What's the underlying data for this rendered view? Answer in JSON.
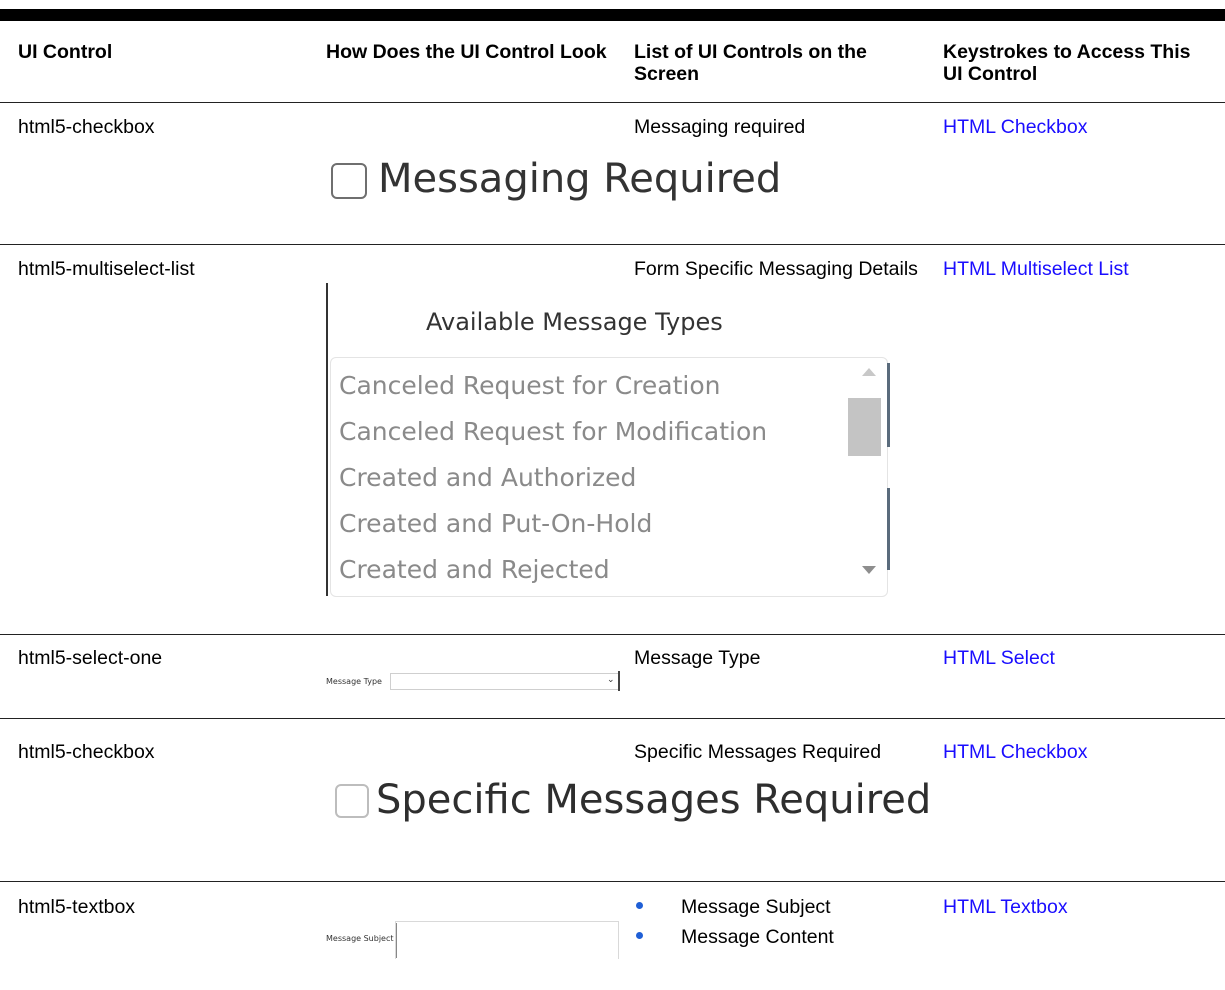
{
  "headers": {
    "col1": "UI Control",
    "col2": "How Does the UI Control Look",
    "col3": "List of UI Controls on the Screen",
    "col4": "Keystrokes to Access This UI Control"
  },
  "rows": [
    {
      "control": "html5-checkbox",
      "screen_controls": "Messaging required",
      "keystroke_link": "HTML Checkbox",
      "illustration_text": "Messaging Required"
    },
    {
      "control": "html5-multiselect-list",
      "screen_controls": "Form Specific Messaging Details",
      "keystroke_link": "HTML Multiselect List",
      "illustration_label": "Available Message Types",
      "illustration_items": [
        "Canceled Request for Creation",
        "Canceled Request for Modification",
        "Created and Authorized",
        "Created and Put-On-Hold",
        "Created and Rejected"
      ]
    },
    {
      "control": "html5-select-one",
      "screen_controls": "Message Type",
      "keystroke_link": "HTML Select",
      "illustration_label": "Message Type"
    },
    {
      "control": "html5-checkbox",
      "screen_controls": "Specific Messages Required",
      "keystroke_link": "HTML Checkbox",
      "illustration_text": "Specific Messages Required"
    },
    {
      "control": "html5-textbox",
      "screen_controls_list": [
        "Message Subject",
        "Message Content"
      ],
      "keystroke_link": "HTML Textbox",
      "illustration_label": "Message Subject"
    }
  ],
  "colors": {
    "link": "#1a0dff",
    "bullet": "#1f5fd6"
  },
  "icons": {
    "scroll_up": "triangle-up-icon",
    "scroll_down": "triangle-down-icon",
    "select_arrow": "chevron-down-icon"
  }
}
